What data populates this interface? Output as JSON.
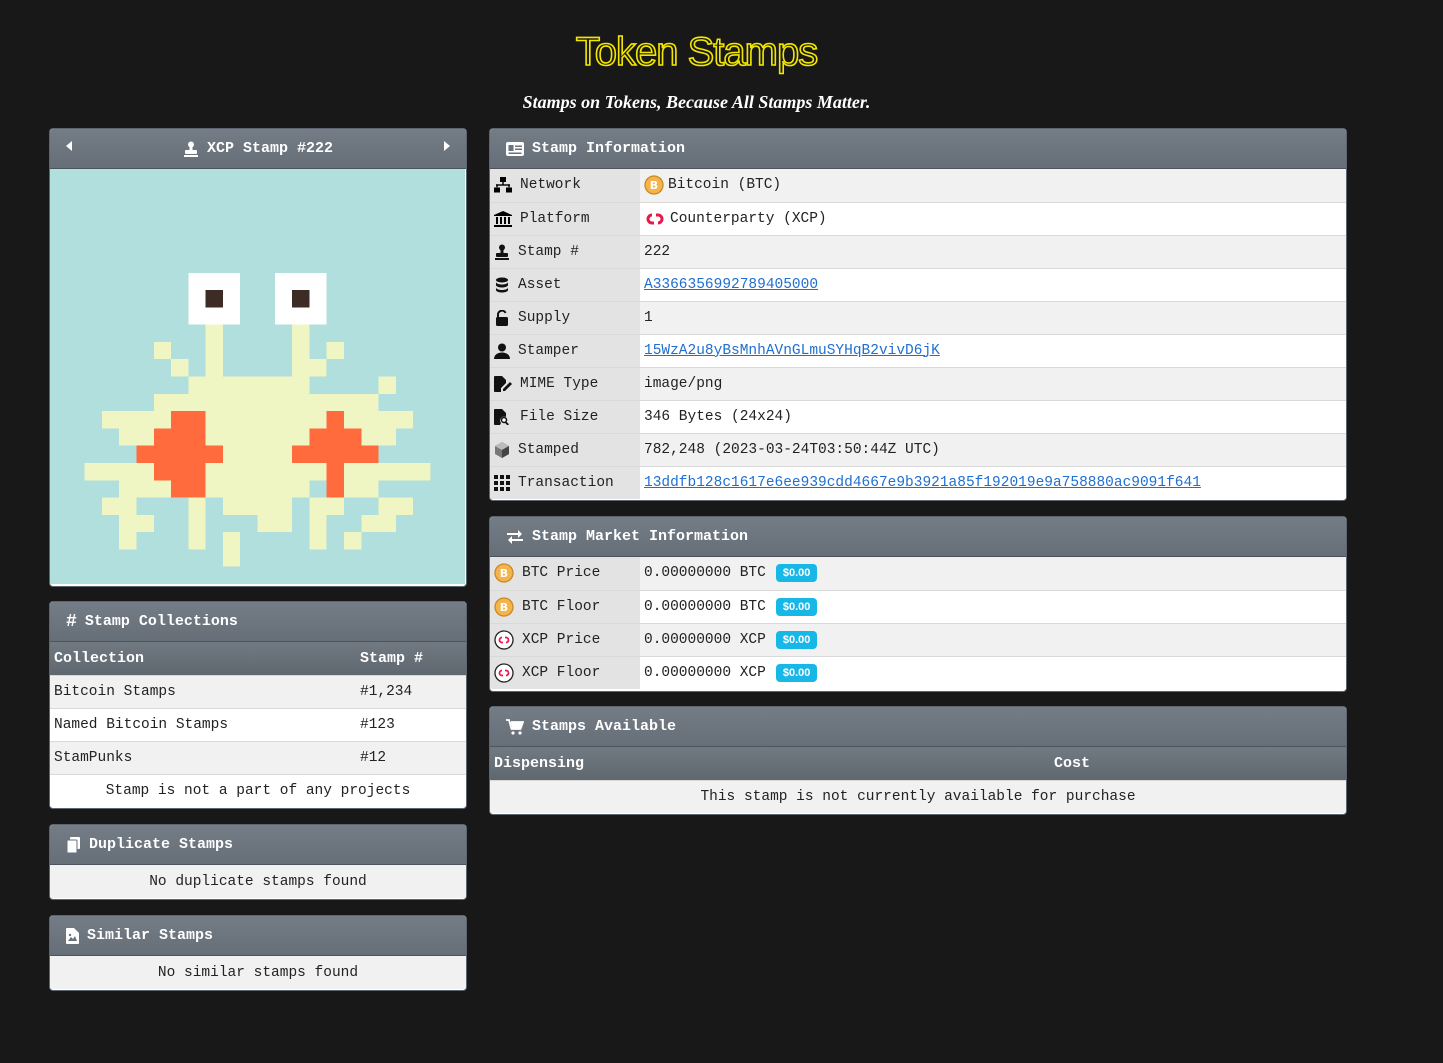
{
  "header": {
    "title": "Token Stamps",
    "subtitle": "Stamps on Tokens, Because All Stamps Matter."
  },
  "stamp_viewer": {
    "title": "XCP Stamp #222",
    "image_alt": "pixel-art-crab-stamp",
    "colors": {
      "background": "#b1dfdd",
      "body": "#f0f5c4",
      "accent": "#ff6b3d",
      "eye_white": "#ffffff",
      "pupil": "#3d2b26"
    }
  },
  "collections": {
    "title": "Stamp Collections",
    "columns": [
      "Collection",
      "Stamp #"
    ],
    "rows": [
      {
        "name": "Bitcoin Stamps",
        "number": "#1,234"
      },
      {
        "name": "Named Bitcoin Stamps",
        "number": "#123"
      },
      {
        "name": "StamPunks",
        "number": "#12"
      }
    ],
    "footer": "Stamp is not a part of any projects"
  },
  "duplicates": {
    "title": "Duplicate Stamps",
    "empty": "No duplicate stamps found"
  },
  "similar": {
    "title": "Similar Stamps",
    "empty": "No similar stamps found"
  },
  "info": {
    "title": "Stamp Information",
    "rows": [
      {
        "label": "Network",
        "value": "Bitcoin (BTC)",
        "icon": "network-icon"
      },
      {
        "label": "Platform",
        "value": "Counterparty (XCP)",
        "icon": "bank-icon"
      },
      {
        "label": "Stamp #",
        "value": "222",
        "icon": "stamp-icon"
      },
      {
        "label": "Asset",
        "value": "A3366356992789405000",
        "icon": "database-icon"
      },
      {
        "label": "Supply",
        "value": "1",
        "icon": "unlock-icon"
      },
      {
        "label": "Stamper",
        "value": "15WzA2u8yBsMnhAVnGLmuSYHqB2vivD6jK",
        "icon": "user-icon"
      },
      {
        "label": "MIME Type",
        "value": "image/png",
        "icon": "file-signature-icon"
      },
      {
        "label": "File Size",
        "value": "346 Bytes (24x24)",
        "icon": "file-search-icon"
      },
      {
        "label": "Stamped",
        "value": "782,248 (2023-03-24T03:50:44Z UTC)",
        "icon": "cube-icon"
      },
      {
        "label": "Transaction",
        "value": "13ddfb128c1617e6ee939cdd4667e9b3921a85f192019e9a758880ac9091f641",
        "icon": "grid-icon"
      }
    ]
  },
  "market": {
    "title": "Stamp Market Information",
    "rows": [
      {
        "label": "BTC Price",
        "value": "0.00000000 BTC",
        "usd": "$0.00",
        "icon": "bitcoin-icon"
      },
      {
        "label": "BTC Floor",
        "value": "0.00000000 BTC",
        "usd": "$0.00",
        "icon": "bitcoin-icon"
      },
      {
        "label": "XCP Price",
        "value": "0.00000000 XCP",
        "usd": "$0.00",
        "icon": "counterparty-icon"
      },
      {
        "label": "XCP Floor",
        "value": "0.00000000 XCP",
        "usd": "$0.00",
        "icon": "counterparty-icon"
      }
    ]
  },
  "available": {
    "title": "Stamps Available",
    "columns": [
      "Dispensing",
      "Cost"
    ],
    "empty": "This stamp is not currently available for purchase"
  },
  "colors": {
    "page_bg": "#181818",
    "title_outline": "#f2e600",
    "badge": "#17b7e8",
    "link": "#1f6fd1"
  }
}
